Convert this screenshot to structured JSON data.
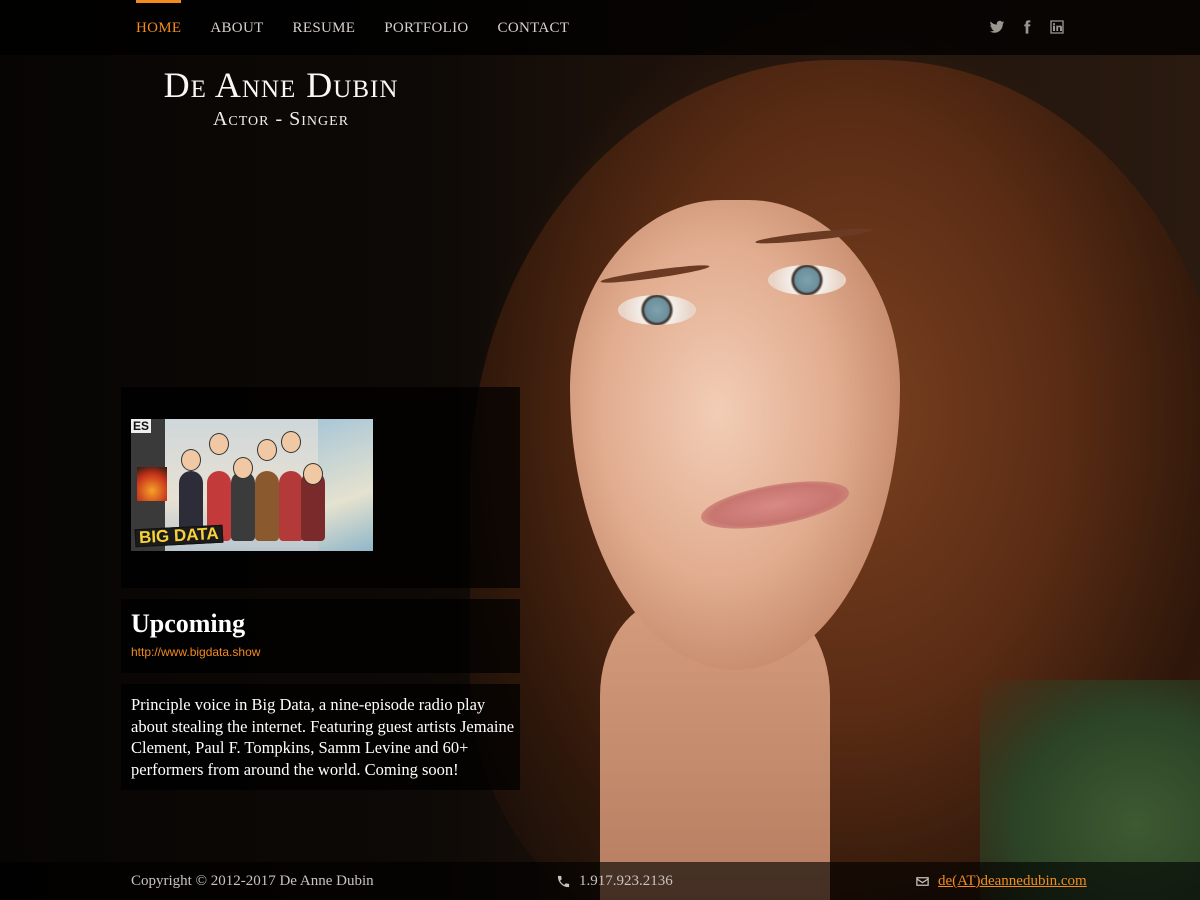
{
  "nav": {
    "items": [
      {
        "label": "HOME",
        "active": true
      },
      {
        "label": "ABOUT",
        "active": false
      },
      {
        "label": "RESUME",
        "active": false
      },
      {
        "label": "PORTFOLIO",
        "active": false
      },
      {
        "label": "CONTACT",
        "active": false
      }
    ],
    "social_icons": [
      "twitter-icon",
      "facebook-icon",
      "linkedin-icon"
    ]
  },
  "logo": {
    "name": "De Anne Dubin",
    "tagline": "Actor  -  Singer"
  },
  "media": {
    "thumbnail_text": "BIG DATA",
    "thumbnail_corner_text": "ES"
  },
  "upcoming": {
    "heading": "Upcoming",
    "link": "http://www.bigdata.show",
    "description": "Principle voice in Big Data, a nine-episode radio play about stealing the internet. Featuring guest artists Jemaine Clement, Paul F. Tompkins, Samm Levine and 60+ performers from around the world. Coming soon!"
  },
  "footer": {
    "copyright": "Copyright © 2012-2017 De Anne Dubin",
    "phone": "1.917.923.2136",
    "email": "de(AT)deannedubin.com"
  },
  "colors": {
    "accent": "#f28b1e",
    "nav_text": "#d7d1cc",
    "panel_bg": "rgba(0,0,0,0.72)"
  }
}
